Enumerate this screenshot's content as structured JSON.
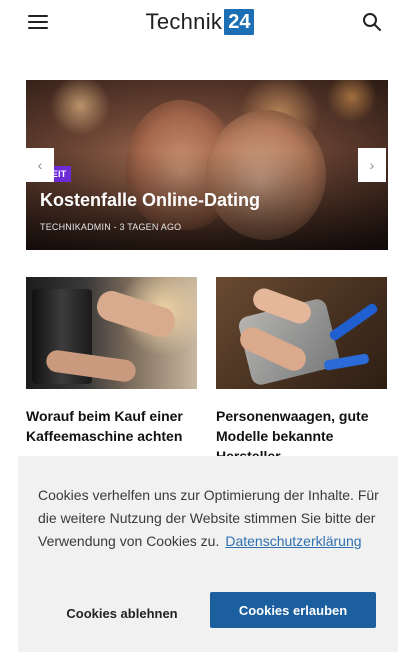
{
  "header": {
    "logo_text": "Technik",
    "logo_badge": "24",
    "brand_color": "#1c6fb5"
  },
  "icons": {
    "menu": "hamburger-menu-icon",
    "search": "search-icon",
    "arrow_left": "chevron-left-icon",
    "arrow_right": "chevron-right-icon"
  },
  "slider": {
    "category": "REIZEIT",
    "category_color": "#6d2bd6",
    "title": "Kostenfalle Online-Dating",
    "meta": "TECHNIKADMIN - 3 TAGEN AGO",
    "arrow_left": "‹",
    "arrow_right": "›"
  },
  "articles": [
    {
      "title": "Worauf beim Kauf einer Kaffeemaschine achten"
    },
    {
      "title": "Personenwaagen, gute Modelle bekannte Hersteller"
    }
  ],
  "cookie_banner": {
    "text": "Cookies verhelfen uns zur Optimierung der Inhalte. Für die weitere Nutzung der Website stimmen Sie bitte der Verwendung von Cookies zu.",
    "link_label": "Datenschutzerklärung",
    "decline_label": "Cookies ablehnen",
    "accept_label": "Cookies erlauben",
    "accept_color": "#1b5f9e"
  }
}
